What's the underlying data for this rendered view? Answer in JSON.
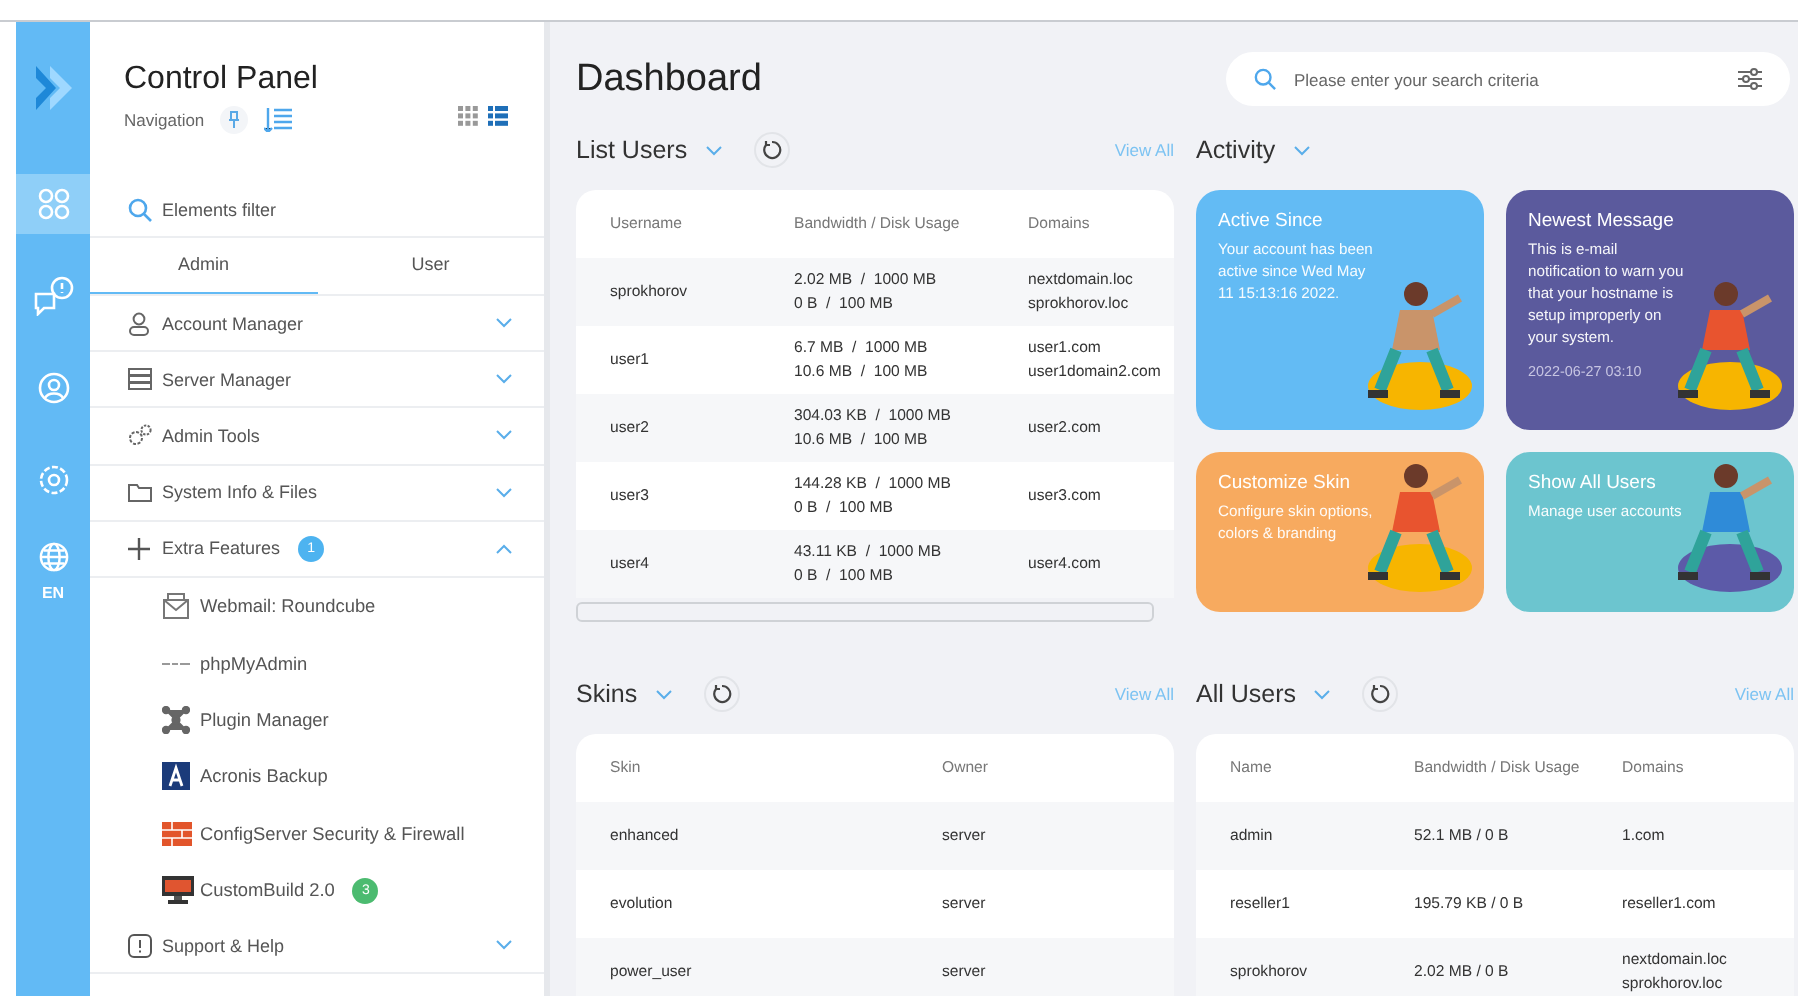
{
  "rail": {
    "items": [
      {
        "selected": true
      },
      {
        "selected": false
      },
      {
        "selected": false
      },
      {
        "selected": false
      },
      {
        "selected": false
      }
    ],
    "language": "EN"
  },
  "sidebar": {
    "title": "Control Panel",
    "subtitle": "Navigation",
    "view": {
      "grid_selected": false,
      "list_selected": true
    },
    "filter_placeholder": "Elements filter",
    "tabs": [
      {
        "label": "Admin",
        "selected": true
      },
      {
        "label": "User",
        "selected": false
      }
    ],
    "items": [
      {
        "label": "Account Manager",
        "expanded": false
      },
      {
        "label": "Server Manager",
        "expanded": false
      },
      {
        "label": "Admin Tools",
        "expanded": false
      },
      {
        "label": "System Info & Files",
        "expanded": false
      },
      {
        "label": "Extra Features",
        "expanded": true,
        "badge": "1",
        "color": "#4db3f0",
        "children": [
          {
            "label": "Webmail: Roundcube"
          },
          {
            "label": "phpMyAdmin"
          },
          {
            "label": "Plugin Manager"
          },
          {
            "label": "Acronis Backup"
          },
          {
            "label": "ConfigServer Security & Firewall"
          },
          {
            "label": "CustomBuild 2.0",
            "badge": "3",
            "color": "#4cbb70"
          }
        ]
      },
      {
        "label": "Support & Help",
        "expanded": false
      }
    ]
  },
  "page": {
    "title": "Dashboard",
    "search_placeholder": "Please enter your search criteria"
  },
  "list_users": {
    "title": "List Users",
    "link": "View All",
    "columns": [
      "Username",
      "Bandwidth / Disk Usage",
      "Domains"
    ],
    "rows": [
      {
        "name": "sprokhorov",
        "usage": [
          "2.02 MB  /  1000 MB",
          "0 B  /  100 MB"
        ],
        "domains": [
          "nextdomain.loc",
          "sprokhorov.loc"
        ]
      },
      {
        "name": "user1",
        "usage": [
          "6.7 MB  /  1000 MB",
          "10.6 MB  /  100 MB"
        ],
        "domains": [
          "user1.com",
          "user1domain2.com"
        ]
      },
      {
        "name": "user2",
        "usage": [
          "304.03 KB  /  1000 MB",
          "10.6 MB  /  100 MB"
        ],
        "domains": [
          "user2.com"
        ]
      },
      {
        "name": "user3",
        "usage": [
          "144.28 KB  /  1000 MB",
          "0 B  /  100 MB"
        ],
        "domains": [
          "user3.com"
        ]
      },
      {
        "name": "user4",
        "usage": [
          "43.11 KB  /  1000 MB",
          "0 B  /  100 MB"
        ],
        "domains": [
          "user4.com"
        ]
      }
    ]
  },
  "activity": {
    "title": "Activity",
    "cards": [
      {
        "title": "Active Since",
        "text": "Your account has been active since Wed May 11 15:13:16 2022.",
        "color": "#63bbf4"
      },
      {
        "title": "Newest Message",
        "text": "This is e-mail notification to warn you that your hostname is setup improperly on your system.",
        "date": "2022-06-27 03:10",
        "color": "#5b5a9d"
      },
      {
        "title": "Customize Skin",
        "text": "Configure skin options, colors & branding",
        "color": "#f7aa5f"
      },
      {
        "title": "Show All Users",
        "text": "Manage user accounts",
        "color": "#6cc5cf"
      }
    ]
  },
  "skins": {
    "title": "Skins",
    "link": "View All",
    "columns": [
      "Skin",
      "Owner"
    ],
    "rows": [
      [
        "enhanced",
        "server"
      ],
      [
        "evolution",
        "server"
      ],
      [
        "power_user",
        "server"
      ]
    ]
  },
  "all_users": {
    "title": "All Users",
    "link": "View All",
    "columns": [
      "Name",
      "Bandwidth / Disk Usage",
      "Domains"
    ],
    "rows": [
      {
        "name": "admin",
        "usage": [
          "52.1 MB / 0 B"
        ],
        "domains": [
          "1.com"
        ]
      },
      {
        "name": "reseller1",
        "usage": [
          "195.79 KB / 0 B"
        ],
        "domains": [
          "reseller1.com"
        ]
      },
      {
        "name": "sprokhorov",
        "usage": [
          "2.02 MB / 0 B"
        ],
        "domains": [
          "nextdomain.loc",
          "sprokhorov.loc"
        ]
      }
    ]
  }
}
